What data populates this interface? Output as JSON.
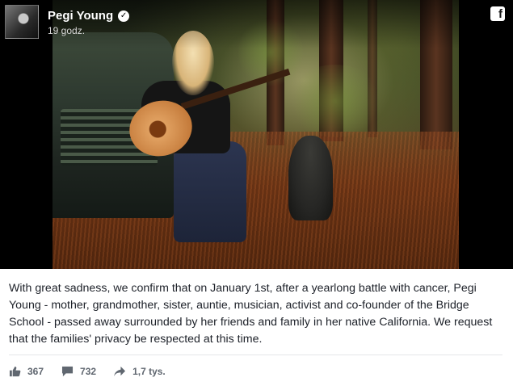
{
  "post": {
    "author": "Pegi Young",
    "timestamp": "19 godz.",
    "avatar_icon": "avatar-photo",
    "verified_icon": "verified-badge-icon",
    "platform_icon": "facebook-icon",
    "platform_glyph": "f",
    "image_description_icon": "photo",
    "caption": "With great sadness, we confirm that on January 1st, after a yearlong battle with cancer, Pegi Young - mother, grandmother, sister, auntie, musician, activist and co-founder of the Bridge School - passed away surrounded by her friends and family in her native California. We request that the families' privacy be respected at this time."
  },
  "engagement": {
    "likes": "367",
    "comments": "732",
    "shares": "1,7 tys."
  }
}
